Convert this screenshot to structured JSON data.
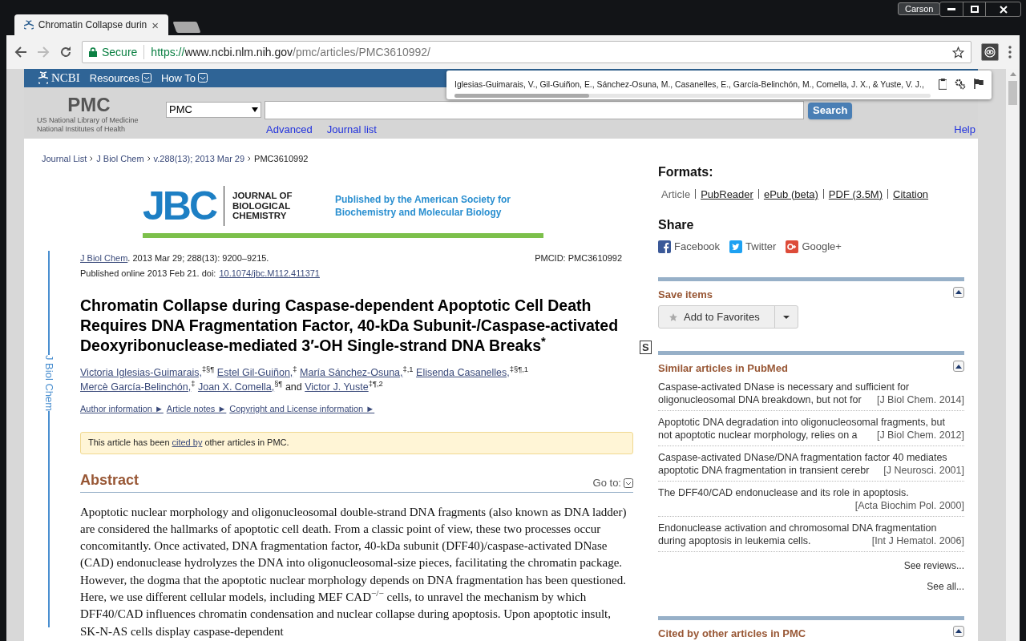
{
  "browser": {
    "tab": {
      "title": "Chromatin Collapse durin",
      "close": "×"
    },
    "profile": "Carson",
    "address": {
      "secure_label": "Secure",
      "scheme": "https://",
      "host": "www.ncbi.nlm.nih.gov",
      "path": "/pmc/articles/PMC3610992/"
    }
  },
  "citation_popup": {
    "text": "Iglesias-Guimarais, V., Gil-Guiñon, E., Sánchez-Osuna, M., Casanelles, E., García-Belinchón, M., Comella, J. X., & Yuste, V. J.,"
  },
  "ncbi_bar": {
    "logo": "NCBI",
    "menus": [
      "Resources",
      "How To"
    ]
  },
  "search": {
    "logo": "PMC",
    "org_lines": [
      "US National Library of Medicine",
      "National Institutes of Health"
    ],
    "database": "PMC",
    "button": "Search",
    "links": [
      "Advanced",
      "Journal list"
    ],
    "help": "Help"
  },
  "breadcrumb": [
    {
      "label": "Journal List",
      "link": true
    },
    {
      "label": "J Biol Chem",
      "link": true
    },
    {
      "label": "v.288(13); 2013 Mar 29",
      "link": true
    },
    {
      "label": "PMC3610992",
      "link": false
    }
  ],
  "journal_banner": {
    "logo": "JBC",
    "name_lines": [
      "JOURNAL OF",
      "BIOLOGICAL",
      "CHEMISTRY"
    ],
    "publisher_lines": [
      "Published by the American Society for",
      "Biochemistry and Molecular Biology"
    ]
  },
  "side_label": "J Biol Chem",
  "article": {
    "journal": "J Biol Chem",
    "citation": ". 2013 Mar 29; 288(13): 9200–9215.",
    "pmcid": "PMCID: PMC3610992",
    "published": "Published online 2013 Feb 21. doi:",
    "doi": "10.1074/jbc.M112.411371",
    "title": "Chromatin Collapse during Caspase-dependent Apoptotic Cell Death Requires DNA Fragmentation Factor, 40-kDa Subunit-/Caspase-activated Deoxyribonuclease-mediated 3′-OH Single-strand DNA Breaks$^{*}$",
    "supplement": "S",
    "authors": [
      {
        "name": "Victoria Iglesias-Guimarais,",
        "marks": "‡§¶"
      },
      {
        "name": "Estel Gil-Guiñon,",
        "marks": "‡"
      },
      {
        "name": "María Sánchez-Osuna,",
        "marks": "‡,1"
      },
      {
        "name": "Elisenda Casanelles,",
        "marks": "‡§¶,1"
      },
      {
        "name": "Mercè García-Belinchón,",
        "marks": "‡"
      },
      {
        "name": "Joan X. Comella,",
        "marks": "§¶"
      },
      {
        "name": "Victor J. Yuste",
        "marks": "‡¶,2"
      }
    ],
    "conjunction": "and",
    "info_links": [
      "Author information ►",
      "Article notes ►",
      "Copyright and License information ►"
    ],
    "notice": {
      "before": "This article has been",
      "link": "cited by",
      "after": "other articles in PMC."
    }
  },
  "abstract": {
    "heading": "Abstract",
    "goto": "Go to:",
    "text": "Apoptotic nuclear morphology and oligonucleosomal double-strand DNA fragments (also known as DNA ladder) are considered the hallmarks of apoptotic cell death. From a classic point of view, these two processes occur concomitantly. Once activated, DNA fragmentation factor, 40-kDa subunit (DFF40)/caspase-activated DNase (CAD) endonuclease hydrolyzes the DNA into oligonucleosomal-size pieces, facilitating the chromatin package. However, the dogma that the apoptotic nuclear morphology depends on DNA fragmentation has been questioned. Here, we use different cellular models, including MEF CAD$^{−/−}$ cells, to unravel the mechanism by which DFF40/CAD influences chromatin condensation and nuclear collapse during apoptosis. Upon apoptotic insult, SK-N-AS cells display caspase-dependent"
  },
  "sidebar": {
    "formats_heading": "Formats:",
    "formats": [
      {
        "label": "Article",
        "selected": true
      },
      {
        "label": "PubReader",
        "selected": false
      },
      {
        "label": "ePub (beta)",
        "selected": false
      },
      {
        "label": "PDF (3.5M)",
        "selected": false
      },
      {
        "label": "Citation",
        "selected": false
      }
    ],
    "share_heading": "Share",
    "share": [
      {
        "label": "Facebook",
        "kind": "facebook"
      },
      {
        "label": "Twitter",
        "kind": "twitter"
      },
      {
        "label": "Google+",
        "kind": "google"
      }
    ],
    "save": {
      "heading": "Save items",
      "button": "Add to Favorites"
    },
    "similar": {
      "heading": "Similar articles in PubMed",
      "items": [
        {
          "lines": [
            "Caspase-activated DNase is necessary and sufficient for",
            "oligonucleosomal DNA breakdown, but not for"
          ],
          "source": "[J Biol Chem. 2014]"
        },
        {
          "lines": [
            "Apoptotic DNA degradation into oligonucleosomal fragments, but",
            "not apoptotic nuclear morphology, relies on a"
          ],
          "source": "[J Biol Chem. 2012]"
        },
        {
          "lines": [
            "Caspase-activated DNase/DNA fragmentation factor 40 mediates",
            "apoptotic DNA fragmentation in transient cerebr"
          ],
          "source": "[J Neurosci. 2001]"
        },
        {
          "lines": [
            "The DFF40/CAD endonuclease and its role in apoptosis."
          ],
          "source": "[Acta Biochim Pol. 2000]"
        },
        {
          "lines": [
            "Endonuclease activation and chromosomal DNA fragmentation",
            "during apoptosis in leukemia cells."
          ],
          "source": "[Int J Hematol. 2006]"
        }
      ],
      "more": [
        "See reviews...",
        "See all..."
      ]
    },
    "cited": {
      "heading": "Cited by other articles in PMC"
    }
  }
}
